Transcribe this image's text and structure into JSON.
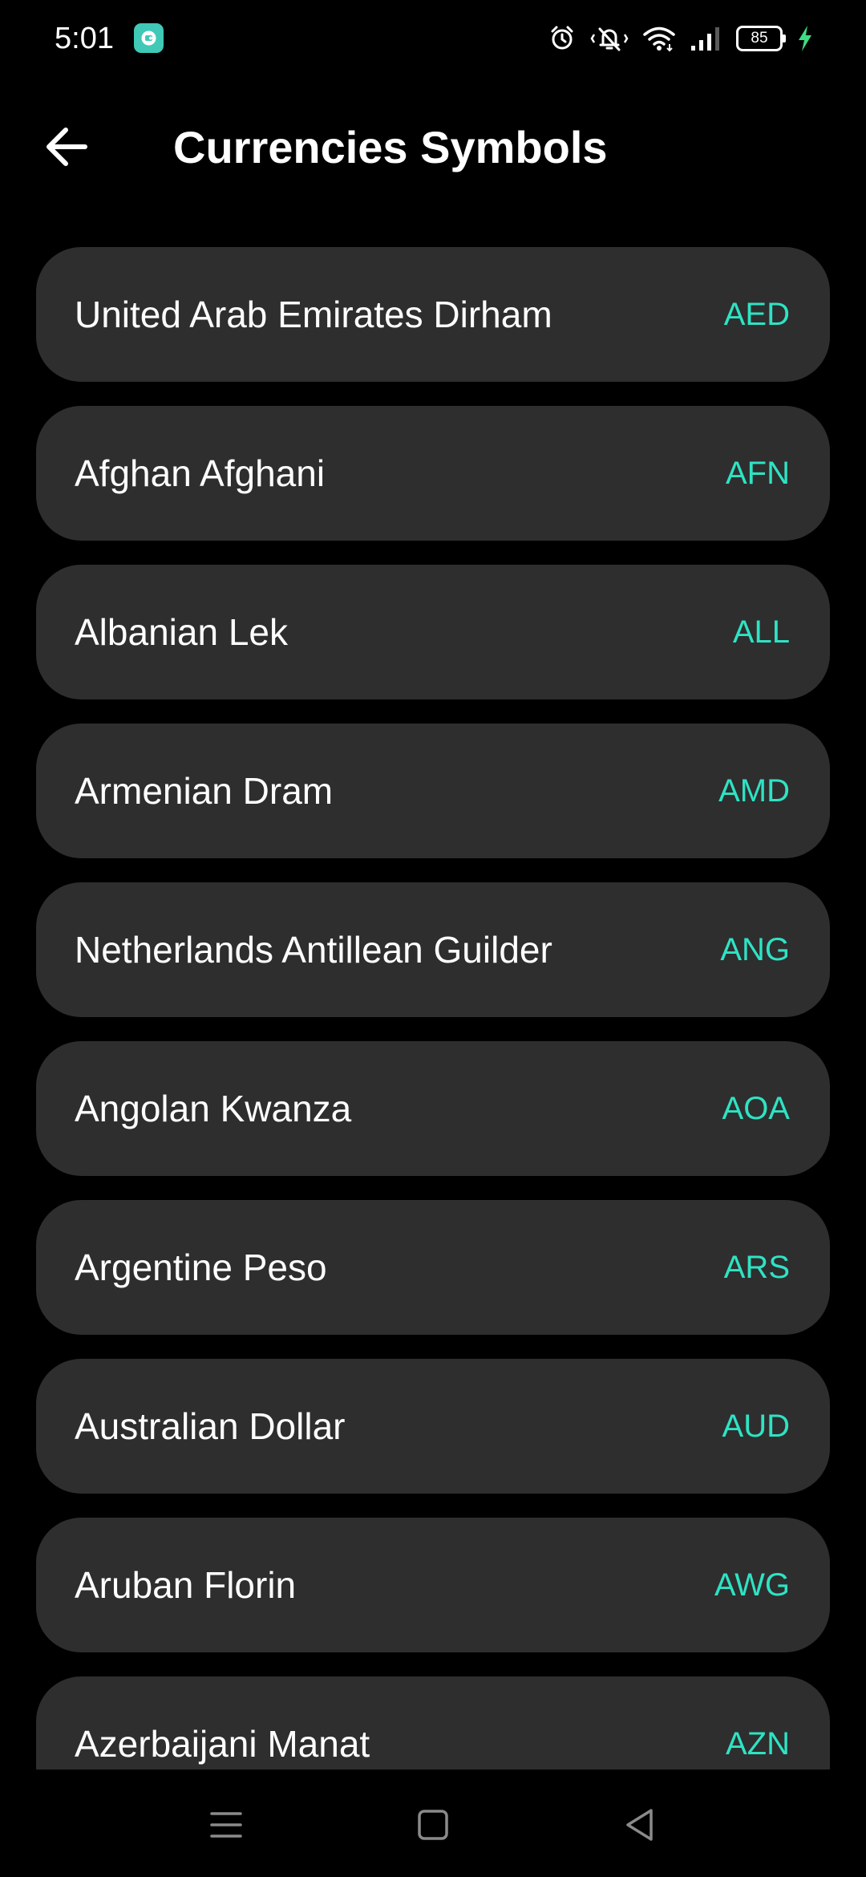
{
  "status_bar": {
    "time": "5:01",
    "battery_level": "85",
    "icons": [
      "app-notification-icon",
      "alarm-icon",
      "vibrate-icon",
      "wifi-icon",
      "signal-icon",
      "battery-icon",
      "charging-icon"
    ]
  },
  "header": {
    "title": "Currencies Symbols",
    "back_icon": "arrow-left-icon"
  },
  "colors": {
    "background": "#000000",
    "card": "#2e2e2e",
    "accent": "#2ee3c4",
    "text": "#ffffff",
    "charging": "#3ddc84"
  },
  "currencies": [
    {
      "name": "United Arab Emirates Dirham",
      "code": "AED"
    },
    {
      "name": "Afghan Afghani",
      "code": "AFN"
    },
    {
      "name": "Albanian Lek",
      "code": "ALL"
    },
    {
      "name": "Armenian Dram",
      "code": "AMD"
    },
    {
      "name": "Netherlands Antillean Guilder",
      "code": "ANG"
    },
    {
      "name": "Angolan Kwanza",
      "code": "AOA"
    },
    {
      "name": "Argentine Peso",
      "code": "ARS"
    },
    {
      "name": "Australian Dollar",
      "code": "AUD"
    },
    {
      "name": "Aruban Florin",
      "code": "AWG"
    },
    {
      "name": "Azerbaijani Manat",
      "code": "AZN"
    }
  ],
  "nav_bar": {
    "buttons": [
      "menu-icon",
      "home-icon",
      "back-triangle-icon"
    ]
  }
}
